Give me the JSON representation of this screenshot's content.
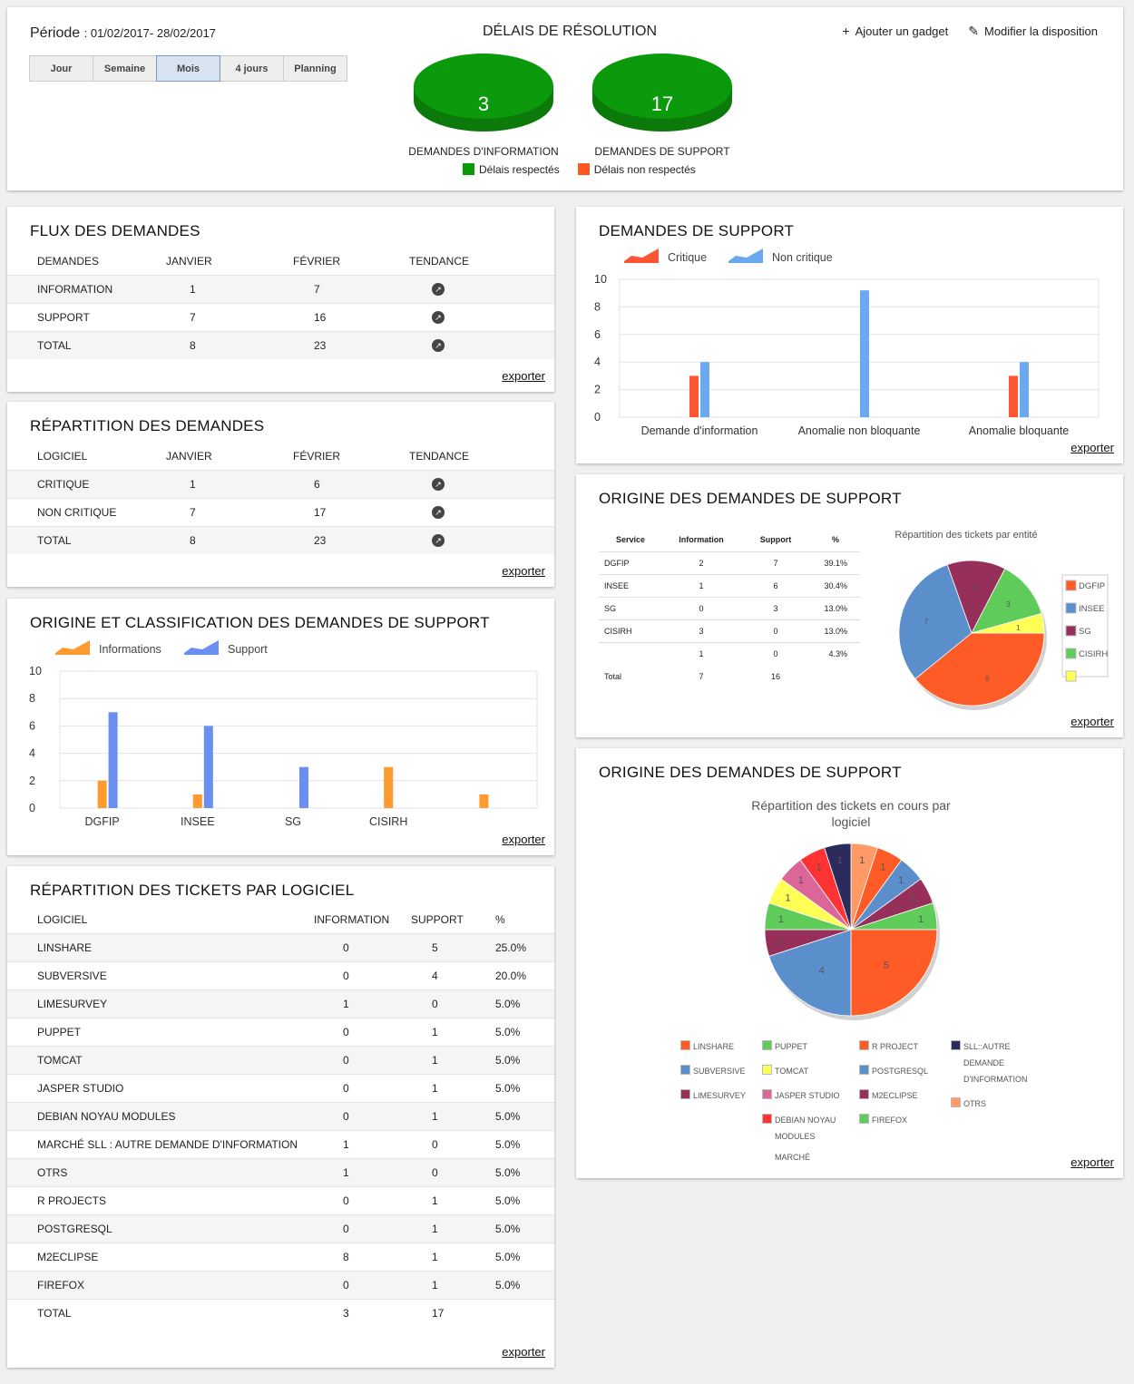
{
  "top": {
    "periode_label": "Période",
    "periode_value": ": 01/02/2017- 28/02/2017",
    "buttons": [
      "Jour",
      "Semaine",
      "Mois",
      "4 jours",
      "Planning"
    ],
    "active_button": "Mois",
    "title": "DÉLAIS DE RÉSOLUTION",
    "add_gadget": "Ajouter un gadget",
    "edit_layout": "Modifier la disposition",
    "pills": [
      {
        "value": "3",
        "label": "DEMANDES D'INFORMATION"
      },
      {
        "value": "17",
        "label": "DEMANDES DE SUPPORT"
      }
    ],
    "legend": [
      {
        "label": "Délais respectés",
        "color": "#0a9a0a"
      },
      {
        "label": "Délais non respectés",
        "color": "#ff5722"
      }
    ]
  },
  "export_label": "exporter",
  "flux": {
    "title": "FLUX DES DEMANDES",
    "headers": [
      "DEMANDES",
      "JANVIER",
      "FÉVRIER",
      "TENDANCE"
    ],
    "rows": [
      [
        "INFORMATION",
        "1",
        "7"
      ],
      [
        "SUPPORT",
        "7",
        "16"
      ],
      [
        "TOTAL",
        "8",
        "23"
      ]
    ]
  },
  "repartition": {
    "title": "RÉPARTITION DES DEMANDES",
    "headers": [
      "LOGICIEL",
      "JANVIER",
      "FÉVRIER",
      "TENDANCE"
    ],
    "rows": [
      [
        "CRITIQUE",
        "1",
        "6"
      ],
      [
        "NON CRITIQUE",
        "7",
        "17"
      ],
      [
        "TOTAL",
        "8",
        "23"
      ]
    ]
  },
  "classification": {
    "title": "ORIGINE ET CLASSIFICATION DES DEMANDES DE SUPPORT"
  },
  "tickets": {
    "title": "RÉPARTITION DES TICKETS PAR LOGICIEL",
    "headers": [
      "LOGICIEL",
      "INFORMATION",
      "SUPPORT",
      "%"
    ],
    "rows": [
      [
        "LINSHARE",
        "0",
        "5",
        "25.0%"
      ],
      [
        "SUBVERSIVE",
        "0",
        "4",
        "20.0%"
      ],
      [
        "LIMESURVEY",
        "1",
        "0",
        "5.0%"
      ],
      [
        "PUPPET",
        "0",
        "1",
        "5.0%"
      ],
      [
        "TOMCAT",
        "0",
        "1",
        "5.0%"
      ],
      [
        "JASPER STUDIO",
        "0",
        "1",
        "5.0%"
      ],
      [
        "DEBIAN NOYAU MODULES",
        "0",
        "1",
        "5.0%"
      ],
      [
        "MARCHÉ SLL : AUTRE DEMANDE D'INFORMATION",
        "1",
        "0",
        "5.0%"
      ],
      [
        "OTRS",
        "1",
        "0",
        "5.0%"
      ],
      [
        "R PROJECTS",
        "0",
        "1",
        "5.0%"
      ],
      [
        "POSTGRESQL",
        "0",
        "1",
        "5.0%"
      ],
      [
        "M2ECLIPSE",
        "8",
        "1",
        "5.0%"
      ],
      [
        "FIREFOX",
        "0",
        "1",
        "5.0%"
      ],
      [
        "TOTAL",
        "3",
        "17",
        ""
      ]
    ]
  },
  "support": {
    "title": "DEMANDES DE SUPPORT"
  },
  "origine": {
    "title": "ORIGINE DES DEMANDES DE SUPPORT",
    "headers": [
      "Service",
      "Information",
      "Support",
      "%"
    ],
    "rows": [
      [
        "DGFIP",
        "2",
        "7",
        "39.1%"
      ],
      [
        "INSEE",
        "1",
        "6",
        "30.4%"
      ],
      [
        "SG",
        "0",
        "3",
        "13.0%"
      ],
      [
        "CISIRH",
        "3",
        "0",
        "13.0%"
      ],
      [
        "",
        "1",
        "0",
        "4.3%"
      ],
      [
        "Total",
        "7",
        "16",
        ""
      ]
    ]
  },
  "origine2": {
    "title": "ORIGINE DES DEMANDES DE SUPPORT"
  },
  "chart_data": [
    {
      "type": "bar",
      "categories": [
        "DGFIP",
        "INSEE",
        "SG",
        "CISIRH",
        ""
      ],
      "series": [
        {
          "name": "Informations",
          "values": [
            2,
            1,
            0,
            3,
            1
          ],
          "color": "#ff9a2e"
        },
        {
          "name": "Support",
          "values": [
            7,
            6,
            3,
            0,
            0
          ],
          "color": "#6a8ff0"
        }
      ],
      "ylim": [
        0,
        10
      ],
      "yticks": [
        0,
        2,
        4,
        6,
        8,
        10
      ],
      "grid": true,
      "legend": "top-left"
    },
    {
      "type": "bar",
      "categories": [
        "Demande d'information",
        "Anomalie non bloquante",
        "Anomalie bloquante"
      ],
      "series": [
        {
          "name": "Critique",
          "values": [
            3,
            0,
            3
          ],
          "color": "#ff5533"
        },
        {
          "name": "Non critique",
          "values": [
            4,
            9.2,
            4
          ],
          "color": "#6aa9f0"
        }
      ],
      "ylim": [
        0,
        10
      ],
      "yticks": [
        0,
        2,
        4,
        6,
        8,
        10
      ],
      "grid": true,
      "legend": "top-left"
    },
    {
      "type": "pie",
      "title": "Répartition des tickets par entité",
      "slices": [
        {
          "label": "DGFIP",
          "value": 9,
          "color": "#ff5b26"
        },
        {
          "label": "INSEE",
          "value": 7,
          "color": "#5b8fcc"
        },
        {
          "label": "SG",
          "value": 3,
          "color": "#96305a"
        },
        {
          "label": "CISIRH",
          "value": 3,
          "color": "#5fcc5a"
        },
        {
          "label": "",
          "value": 1,
          "color": "#ffff55"
        }
      ],
      "legend": "right"
    },
    {
      "type": "pie",
      "title": "Répartition des tickets en cours par logiciel",
      "slices": [
        {
          "label": "LINSHARE",
          "value": 5,
          "color": "#ff5b26"
        },
        {
          "label": "SUBVERSIVE",
          "value": 4,
          "color": "#5b8fcc"
        },
        {
          "label": "LIMESURVEY",
          "value": 1,
          "color": "#96305a"
        },
        {
          "label": "PUPPET",
          "value": 1,
          "color": "#5fcc5a"
        },
        {
          "label": "TOMCAT",
          "value": 1,
          "color": "#ffff55"
        },
        {
          "label": "JASPER STUDIO",
          "value": 1,
          "color": "#dd6699"
        },
        {
          "label": "DEBIAN NOYAU MODULES",
          "value": 1,
          "color": "#ff3333"
        },
        {
          "label": "SLL::AUTRE DEMANDE D'INFORMATION",
          "value": 1,
          "color": "#2b2b5e"
        },
        {
          "label": "OTRS",
          "value": 1,
          "color": "#ff9966"
        },
        {
          "label": "R PROJECT",
          "value": 1,
          "color": "#ff5b26"
        },
        {
          "label": "POSTGRESQL",
          "value": 1,
          "color": "#5b8fcc"
        },
        {
          "label": "M2ECLIPSE",
          "value": 1,
          "color": "#96305a"
        },
        {
          "label": "FIREFOX",
          "value": 1,
          "color": "#5fcc5a"
        }
      ],
      "legend_extra": "MARCHÉ",
      "legend": "bottom"
    }
  ]
}
